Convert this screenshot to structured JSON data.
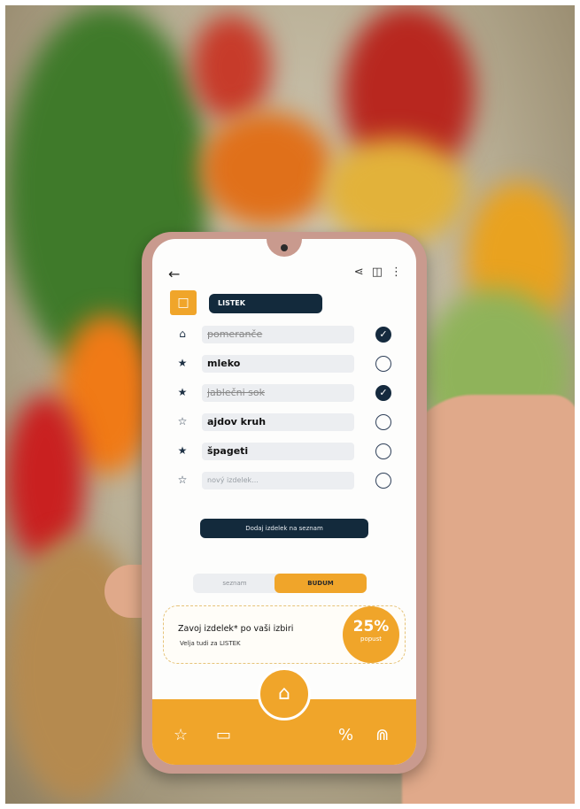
{
  "toolbar": {
    "back_icon": "arrow-left-icon",
    "icons": [
      "share-icon",
      "folder-icon",
      "more-vertical-icon"
    ]
  },
  "list": {
    "category_icon": "bag-icon",
    "name": "LISTEK"
  },
  "items": [
    {
      "icon": "home-icon",
      "text": "pomeranče",
      "style": "done",
      "checked": true
    },
    {
      "icon": "star-icon",
      "text": "mleko",
      "style": "bold",
      "checked": false
    },
    {
      "icon": "star-icon",
      "text": "jablečni sok",
      "style": "done",
      "checked": true
    },
    {
      "icon": "star-outline-icon",
      "text": "ajdov kruh",
      "style": "bold",
      "checked": false
    },
    {
      "icon": "star-icon",
      "text": "špageti",
      "style": "bold",
      "checked": false
    },
    {
      "icon": "star-outline-icon",
      "text": "nový izdelek...",
      "style": "ph",
      "checked": false
    }
  ],
  "add_button": "Dodaj izdelek na seznam",
  "toggle": {
    "left": "seznam",
    "right": "BUDUM"
  },
  "promo": {
    "title": "Zavoj izdelek* po vaši izbiri",
    "subtitle": "Velja tudi za LISTEK",
    "percent": "25%",
    "badge_label": "popust"
  },
  "navbar": {
    "home_icon": "home-icon",
    "icons": [
      "star-outline-icon",
      "folder-icon",
      "percent-icon",
      "cart-icon"
    ]
  },
  "colors": {
    "accent": "#f0a52a",
    "navy": "#132a3c",
    "screen": "#fdfdfc"
  }
}
